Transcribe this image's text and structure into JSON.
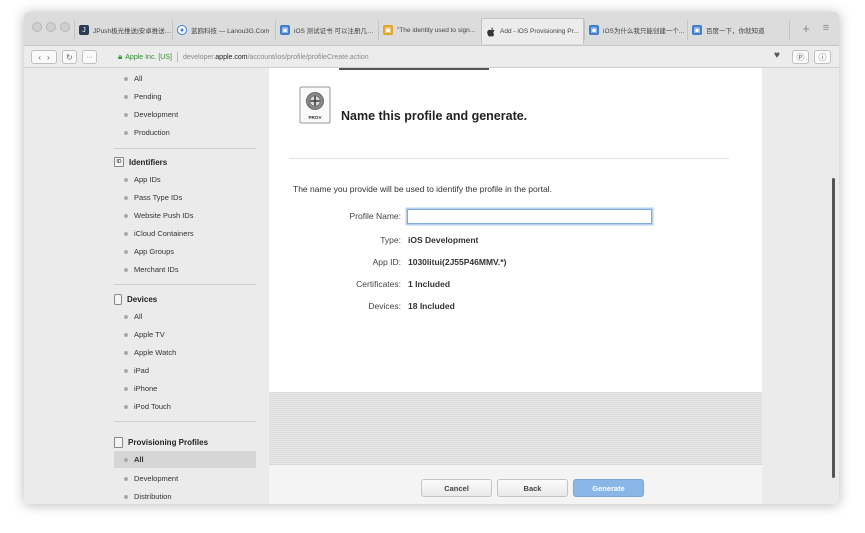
{
  "browser": {
    "tabs": [
      {
        "title": "JPush极光推送|安卓推送|i...",
        "color": "#2b3b55",
        "glyph": "J"
      },
      {
        "title": "蓝鸥科技 — Lanou3G.Com",
        "color": "#f0f0f0",
        "glyph": "●"
      },
      {
        "title": "iOS 测试证书 可以注册几个...",
        "color": "#3d7ecf",
        "glyph": "▣"
      },
      {
        "title": "\"The identity used to sign...",
        "color": "#e0a62a",
        "glyph": "▣"
      },
      {
        "title": "Add - iOS Provisioning Pr...",
        "color": "#ececec",
        "glyph": "",
        "active": true
      },
      {
        "title": "iOS为什么我只能创建一个...",
        "color": "#3d7ecf",
        "glyph": "▣"
      },
      {
        "title": "百度一下，你就知道",
        "color": "#3d7ecf",
        "glyph": "▣"
      }
    ],
    "new_tab_glyph": "+",
    "tab_overview_glyph": "≡",
    "url": {
      "org": "Apple Inc. [US]",
      "prefix": "developer.",
      "host": "apple.com",
      "path": "/account/ios/profile/profileCreate.action"
    }
  },
  "sidebar": {
    "top_items": [
      "All",
      "Pending",
      "Development",
      "Production"
    ],
    "identifiers": {
      "heading": "Identifiers",
      "icon_text": "ID",
      "items": [
        "App IDs",
        "Pass Type IDs",
        "Website Push IDs",
        "iCloud Containers",
        "App Groups",
        "Merchant IDs"
      ]
    },
    "devices": {
      "heading": "Devices",
      "items": [
        "All",
        "Apple TV",
        "Apple Watch",
        "iPad",
        "iPhone",
        "iPod Touch"
      ]
    },
    "profiles": {
      "heading": "Provisioning Profiles",
      "items": [
        "All",
        "Development",
        "Distribution"
      ],
      "active_index": 0
    }
  },
  "main": {
    "icon_label": "PROV",
    "title": "Name this profile and generate.",
    "intro": "The name you provide will be used to identify the profile in the portal.",
    "fields": {
      "profile_name_label": "Profile Name:",
      "profile_name_value": "",
      "type_label": "Type:",
      "type_value": "iOS Development",
      "app_id_label": "App ID:",
      "app_id_value": "1030litui(2J55P46MMV.*)",
      "certificates_label": "Certificates:",
      "certificates_value": "1 Included",
      "devices_label": "Devices:",
      "devices_value": "18 Included"
    },
    "buttons": {
      "cancel": "Cancel",
      "back": "Back",
      "generate": "Generate"
    }
  }
}
